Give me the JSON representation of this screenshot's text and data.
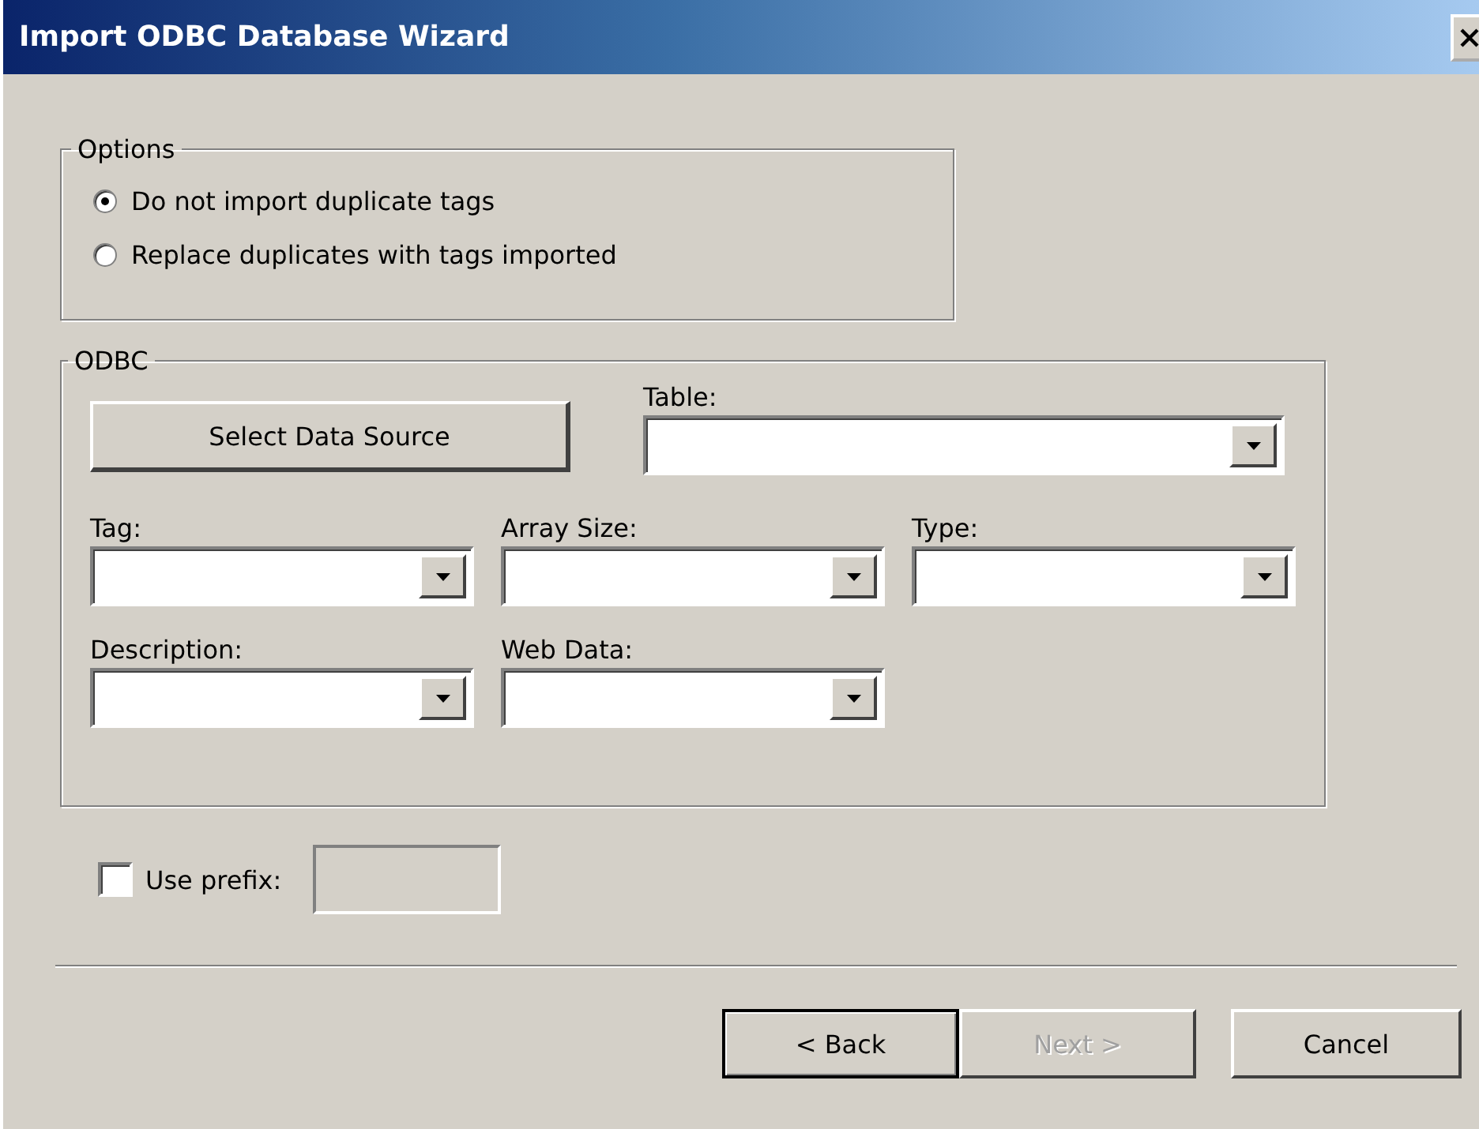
{
  "window": {
    "title": "Import ODBC Database Wizard"
  },
  "options": {
    "legend": "Options",
    "radios": [
      {
        "label": "Do not import duplicate tags",
        "selected": true
      },
      {
        "label": "Replace duplicates with tags imported",
        "selected": false
      }
    ]
  },
  "odbc": {
    "legend": "ODBC",
    "select_button": "Select Data Source",
    "table": {
      "label": "Table:"
    },
    "rows": [
      [
        {
          "label": "Tag:"
        },
        {
          "label": "Array Size:"
        },
        {
          "label": "Type:"
        }
      ],
      [
        {
          "label": "Description:"
        },
        {
          "label": "Web Data:"
        }
      ]
    ]
  },
  "use_prefix": {
    "label": "Use prefix:",
    "checked": false,
    "field_disabled": true
  },
  "buttons": [
    {
      "label": "< Back",
      "disabled": false,
      "default": true
    },
    {
      "label": "Next >",
      "disabled": true,
      "default": false
    },
    {
      "label": "Cancel",
      "disabled": false,
      "default": false
    }
  ]
}
